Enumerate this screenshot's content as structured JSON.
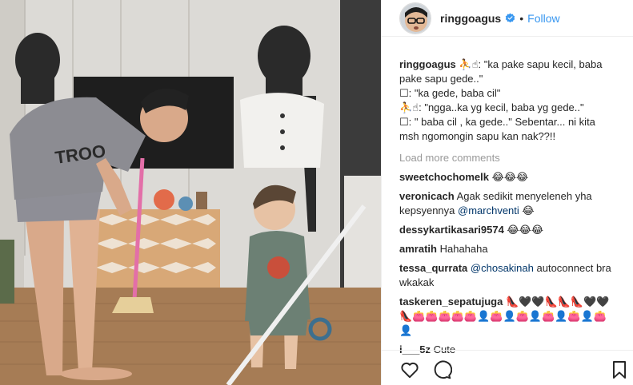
{
  "header": {
    "username": "ringgoagus",
    "dot": "•",
    "follow_label": "Follow",
    "verified_color": "#3897f0"
  },
  "caption": {
    "username": "ringgoagus",
    "lines": [
      "⛹☝: \"ka pake sapu kecil, baba pake sapu gede..\"",
      "☐: \"ka gede, baba cil\"",
      "⛹☝: \"ngga..ka yg kecil, baba yg gede..\"",
      "☐: \" baba cil , ka gede..\" Sebentar... ni kita msh ngomongin sapu kan nak??!!"
    ]
  },
  "load_more": "Load more comments",
  "comments": [
    {
      "user": "sweetchochomelk",
      "text": "😂😂😂"
    },
    {
      "user": "veronicach",
      "text": "Agak sedikit menyeleneh yha kepsyennya",
      "mention": "@marchventi",
      "after": "😂"
    },
    {
      "user": "dessykartikasari9574",
      "text": "😂😂😂"
    },
    {
      "user": "amratih",
      "text": "Hahahaha"
    },
    {
      "user": "tessa_qurrata",
      "text": "",
      "mention": "@chosakinah",
      "after": "autoconnect bra wkakak"
    },
    {
      "user": "taskeren_sepatujuga",
      "text": "👠🖤🖤👠👠👠🖤🖤👠👛👛👛👛👛👤👛👤👛👤👛👤👛👤👛👤"
    },
    {
      "user": "i___5z",
      "text": "Cute"
    }
  ],
  "actions": {
    "like_icon": "heart-outline-icon",
    "comment_icon": "comment-bubble-icon",
    "save_icon": "bookmark-icon"
  },
  "colors": {
    "link": "#3897f0",
    "muted": "#999999",
    "mention": "#003569",
    "text": "#262626",
    "divider": "#efefef"
  }
}
